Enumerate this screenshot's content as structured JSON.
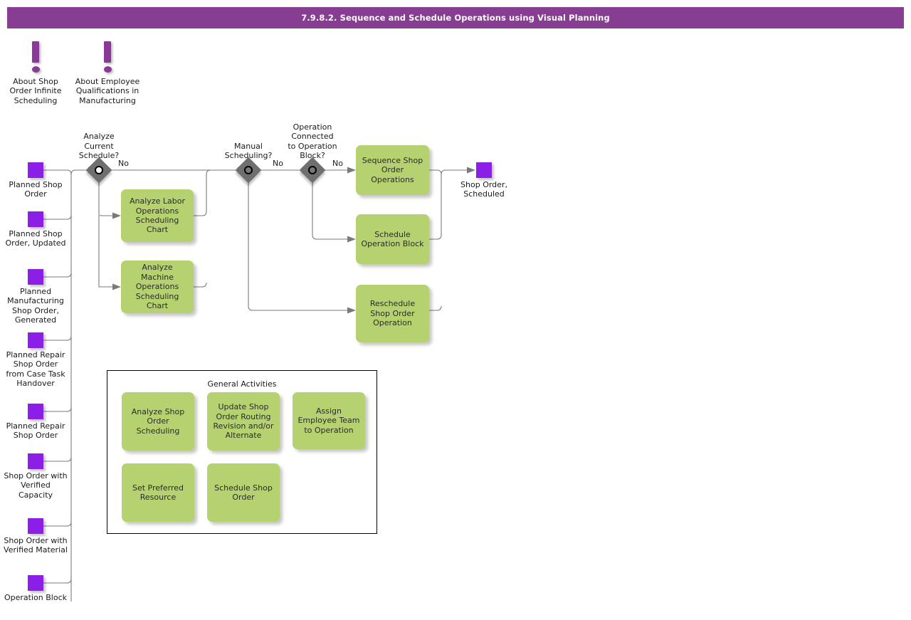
{
  "title": "7.9.8.2. Sequence and Schedule Operations using Visual Planning",
  "colors": {
    "titlebar": "#873d92",
    "activity_green": "#b6d16f",
    "terminal_purple": "#8b1fe8",
    "info_purple": "#893a96",
    "decision_gray": "#6f6f6f",
    "connector_gray": "#7a7a7a"
  },
  "info_nodes": [
    {
      "label": "About Shop\nOrder Infinite\nScheduling",
      "icon": "exclamation-info-icon"
    },
    {
      "label": "About\nEmployee\nQualifications in\nManufacturing",
      "icon": "exclamation-info-icon"
    }
  ],
  "input_terminals": [
    {
      "label": "Planned\nShop Order"
    },
    {
      "label": "Planned\nShop Order,\nUpdated"
    },
    {
      "label": "Planned\nManufacturing\nShop Order,\nGenerated"
    },
    {
      "label": "Planned\nRepair Shop\nOrder from\nCase Task\nHandover"
    },
    {
      "label": "Planned\nRepair Shop\nOrder"
    },
    {
      "label": "Shop Order\nwith\nVerified\nCapacity"
    },
    {
      "label": "Shop Order\nwith\nVerified\nMaterial"
    },
    {
      "label": "Operation\nBlock"
    }
  ],
  "output_terminal": {
    "label": "Shop Order,\nScheduled"
  },
  "decisions": [
    {
      "label": "Analyze\nCurrent\nSchedule?",
      "marker": "hollow"
    },
    {
      "label": "Manual\nScheduling?",
      "marker": "filled"
    },
    {
      "label": "Operation\nConnected\nto Operation\nBlock?",
      "marker": "filled"
    }
  ],
  "edge_labels": [
    {
      "text": "No"
    },
    {
      "text": "No"
    },
    {
      "text": "No"
    }
  ],
  "activities": [
    {
      "label": "Analyze Labor\nOperations\nScheduling\nChart"
    },
    {
      "label": "Analyze Machine\nOperations\nScheduling\nChart"
    },
    {
      "label": "Sequence Shop\nOrder\nOperations"
    },
    {
      "label": "Schedule\nOperation Block"
    },
    {
      "label": "Reschedule\nShop Order\nOperation"
    }
  ],
  "general_activities": {
    "title": "General Activities",
    "items": [
      {
        "label": "Analyze Shop\nOrder\nScheduling"
      },
      {
        "label": "Update Shop\nOrder Routing\nRevision and/or\nAlternate"
      },
      {
        "label": "Assign\nEmployee Team\nto Operation"
      },
      {
        "label": "Set Preferred\nResource"
      },
      {
        "label": "Schedule Shop\nOrder"
      }
    ]
  }
}
